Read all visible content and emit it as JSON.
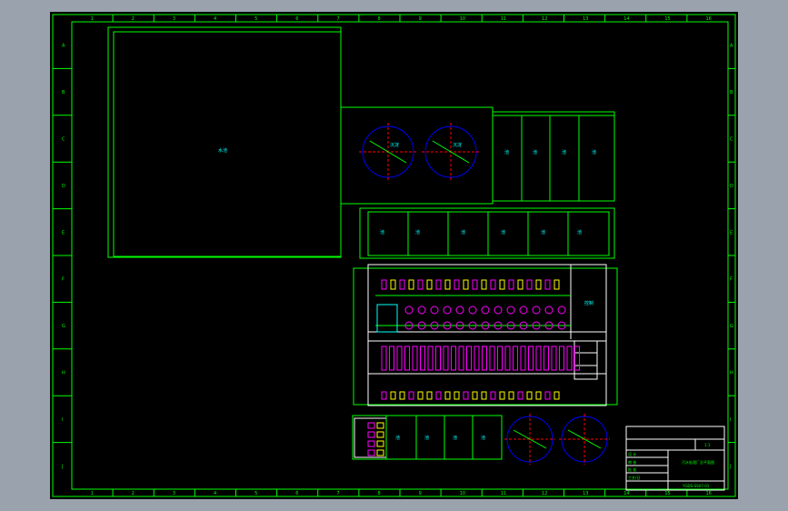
{
  "sheet": {
    "title_text": "污水处理厂总平面图",
    "drawing_no": "YGDS-SS07-01",
    "table_marks": [
      "设 计",
      "审 核",
      "批 准",
      "工艺/日"
    ],
    "block_mark": "1:1"
  },
  "grid": {
    "columns": [
      "1",
      "2",
      "3",
      "4",
      "5",
      "6",
      "7",
      "8",
      "9",
      "10",
      "11",
      "12",
      "13",
      "14",
      "15",
      "16"
    ],
    "rows": [
      "A",
      "B",
      "C",
      "D",
      "E",
      "F",
      "G",
      "H",
      "I",
      "J"
    ]
  },
  "labels": {
    "big_pond": "水池",
    "circle_a": "沉淀",
    "circle_b": "沉淀",
    "tanks_right": [
      "池",
      "池",
      "池",
      "池"
    ],
    "tanks_row": [
      "池",
      "池",
      "池",
      "池",
      "池",
      "池"
    ],
    "bottom_tanks": [
      "池",
      "池",
      "池",
      "池"
    ],
    "bldg_room": "控制"
  },
  "colors": {
    "frame": "#00ff00",
    "accent": "#00ffff",
    "circle": "#0000ff",
    "dash": "#ff0000",
    "equip_magenta": "#ff00ff",
    "equip_yellow": "#ffff00"
  }
}
